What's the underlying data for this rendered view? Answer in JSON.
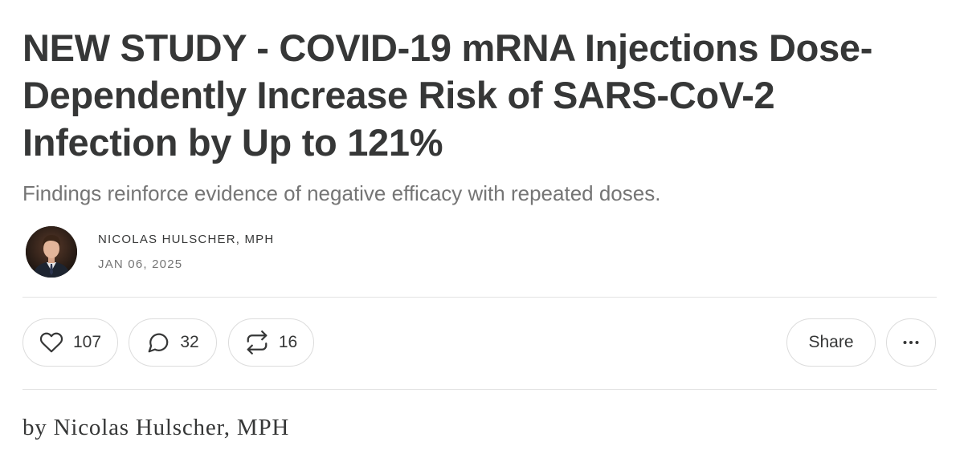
{
  "post": {
    "title": "NEW STUDY - COVID-19 mRNA Injections Dose-Dependently Increase Risk of SARS-CoV-2 Infection by Up to 121%",
    "subtitle": "Findings reinforce evidence of negative efficacy with repeated doses.",
    "author": "NICOLAS HULSCHER, MPH",
    "date": "JAN 06, 2025",
    "body_byline": "by Nicolas Hulscher, MPH"
  },
  "actions": {
    "like": {
      "icon": "heart-icon",
      "count": "107"
    },
    "comment": {
      "icon": "comment-bubble-icon",
      "count": "32"
    },
    "restack": {
      "icon": "restack-arrows-icon",
      "count": "16"
    },
    "share": {
      "label": "Share"
    },
    "more": {
      "icon": "ellipsis-icon"
    }
  },
  "colors": {
    "text": "#363737",
    "muted": "#757575",
    "border": "#dcdcdc",
    "divider": "#e3e3e3",
    "background": "#ffffff"
  }
}
